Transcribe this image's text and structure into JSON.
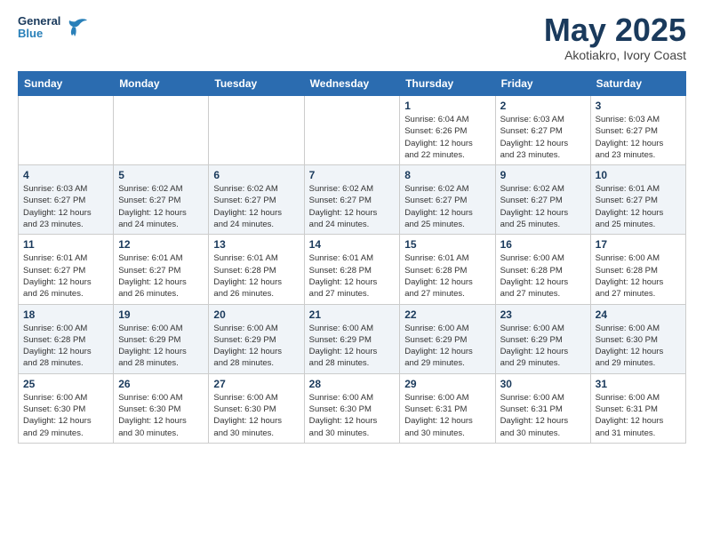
{
  "header": {
    "logo_general": "General",
    "logo_blue": "Blue",
    "month": "May 2025",
    "location": "Akotiakro, Ivory Coast"
  },
  "days_of_week": [
    "Sunday",
    "Monday",
    "Tuesday",
    "Wednesday",
    "Thursday",
    "Friday",
    "Saturday"
  ],
  "weeks": [
    [
      {
        "day": "",
        "info": ""
      },
      {
        "day": "",
        "info": ""
      },
      {
        "day": "",
        "info": ""
      },
      {
        "day": "",
        "info": ""
      },
      {
        "day": "1",
        "info": "Sunrise: 6:04 AM\nSunset: 6:26 PM\nDaylight: 12 hours\nand 22 minutes."
      },
      {
        "day": "2",
        "info": "Sunrise: 6:03 AM\nSunset: 6:27 PM\nDaylight: 12 hours\nand 23 minutes."
      },
      {
        "day": "3",
        "info": "Sunrise: 6:03 AM\nSunset: 6:27 PM\nDaylight: 12 hours\nand 23 minutes."
      }
    ],
    [
      {
        "day": "4",
        "info": "Sunrise: 6:03 AM\nSunset: 6:27 PM\nDaylight: 12 hours\nand 23 minutes."
      },
      {
        "day": "5",
        "info": "Sunrise: 6:02 AM\nSunset: 6:27 PM\nDaylight: 12 hours\nand 24 minutes."
      },
      {
        "day": "6",
        "info": "Sunrise: 6:02 AM\nSunset: 6:27 PM\nDaylight: 12 hours\nand 24 minutes."
      },
      {
        "day": "7",
        "info": "Sunrise: 6:02 AM\nSunset: 6:27 PM\nDaylight: 12 hours\nand 24 minutes."
      },
      {
        "day": "8",
        "info": "Sunrise: 6:02 AM\nSunset: 6:27 PM\nDaylight: 12 hours\nand 25 minutes."
      },
      {
        "day": "9",
        "info": "Sunrise: 6:02 AM\nSunset: 6:27 PM\nDaylight: 12 hours\nand 25 minutes."
      },
      {
        "day": "10",
        "info": "Sunrise: 6:01 AM\nSunset: 6:27 PM\nDaylight: 12 hours\nand 25 minutes."
      }
    ],
    [
      {
        "day": "11",
        "info": "Sunrise: 6:01 AM\nSunset: 6:27 PM\nDaylight: 12 hours\nand 26 minutes."
      },
      {
        "day": "12",
        "info": "Sunrise: 6:01 AM\nSunset: 6:27 PM\nDaylight: 12 hours\nand 26 minutes."
      },
      {
        "day": "13",
        "info": "Sunrise: 6:01 AM\nSunset: 6:28 PM\nDaylight: 12 hours\nand 26 minutes."
      },
      {
        "day": "14",
        "info": "Sunrise: 6:01 AM\nSunset: 6:28 PM\nDaylight: 12 hours\nand 27 minutes."
      },
      {
        "day": "15",
        "info": "Sunrise: 6:01 AM\nSunset: 6:28 PM\nDaylight: 12 hours\nand 27 minutes."
      },
      {
        "day": "16",
        "info": "Sunrise: 6:00 AM\nSunset: 6:28 PM\nDaylight: 12 hours\nand 27 minutes."
      },
      {
        "day": "17",
        "info": "Sunrise: 6:00 AM\nSunset: 6:28 PM\nDaylight: 12 hours\nand 27 minutes."
      }
    ],
    [
      {
        "day": "18",
        "info": "Sunrise: 6:00 AM\nSunset: 6:28 PM\nDaylight: 12 hours\nand 28 minutes."
      },
      {
        "day": "19",
        "info": "Sunrise: 6:00 AM\nSunset: 6:29 PM\nDaylight: 12 hours\nand 28 minutes."
      },
      {
        "day": "20",
        "info": "Sunrise: 6:00 AM\nSunset: 6:29 PM\nDaylight: 12 hours\nand 28 minutes."
      },
      {
        "day": "21",
        "info": "Sunrise: 6:00 AM\nSunset: 6:29 PM\nDaylight: 12 hours\nand 28 minutes."
      },
      {
        "day": "22",
        "info": "Sunrise: 6:00 AM\nSunset: 6:29 PM\nDaylight: 12 hours\nand 29 minutes."
      },
      {
        "day": "23",
        "info": "Sunrise: 6:00 AM\nSunset: 6:29 PM\nDaylight: 12 hours\nand 29 minutes."
      },
      {
        "day": "24",
        "info": "Sunrise: 6:00 AM\nSunset: 6:30 PM\nDaylight: 12 hours\nand 29 minutes."
      }
    ],
    [
      {
        "day": "25",
        "info": "Sunrise: 6:00 AM\nSunset: 6:30 PM\nDaylight: 12 hours\nand 29 minutes."
      },
      {
        "day": "26",
        "info": "Sunrise: 6:00 AM\nSunset: 6:30 PM\nDaylight: 12 hours\nand 30 minutes."
      },
      {
        "day": "27",
        "info": "Sunrise: 6:00 AM\nSunset: 6:30 PM\nDaylight: 12 hours\nand 30 minutes."
      },
      {
        "day": "28",
        "info": "Sunrise: 6:00 AM\nSunset: 6:30 PM\nDaylight: 12 hours\nand 30 minutes."
      },
      {
        "day": "29",
        "info": "Sunrise: 6:00 AM\nSunset: 6:31 PM\nDaylight: 12 hours\nand 30 minutes."
      },
      {
        "day": "30",
        "info": "Sunrise: 6:00 AM\nSunset: 6:31 PM\nDaylight: 12 hours\nand 30 minutes."
      },
      {
        "day": "31",
        "info": "Sunrise: 6:00 AM\nSunset: 6:31 PM\nDaylight: 12 hours\nand 31 minutes."
      }
    ]
  ]
}
